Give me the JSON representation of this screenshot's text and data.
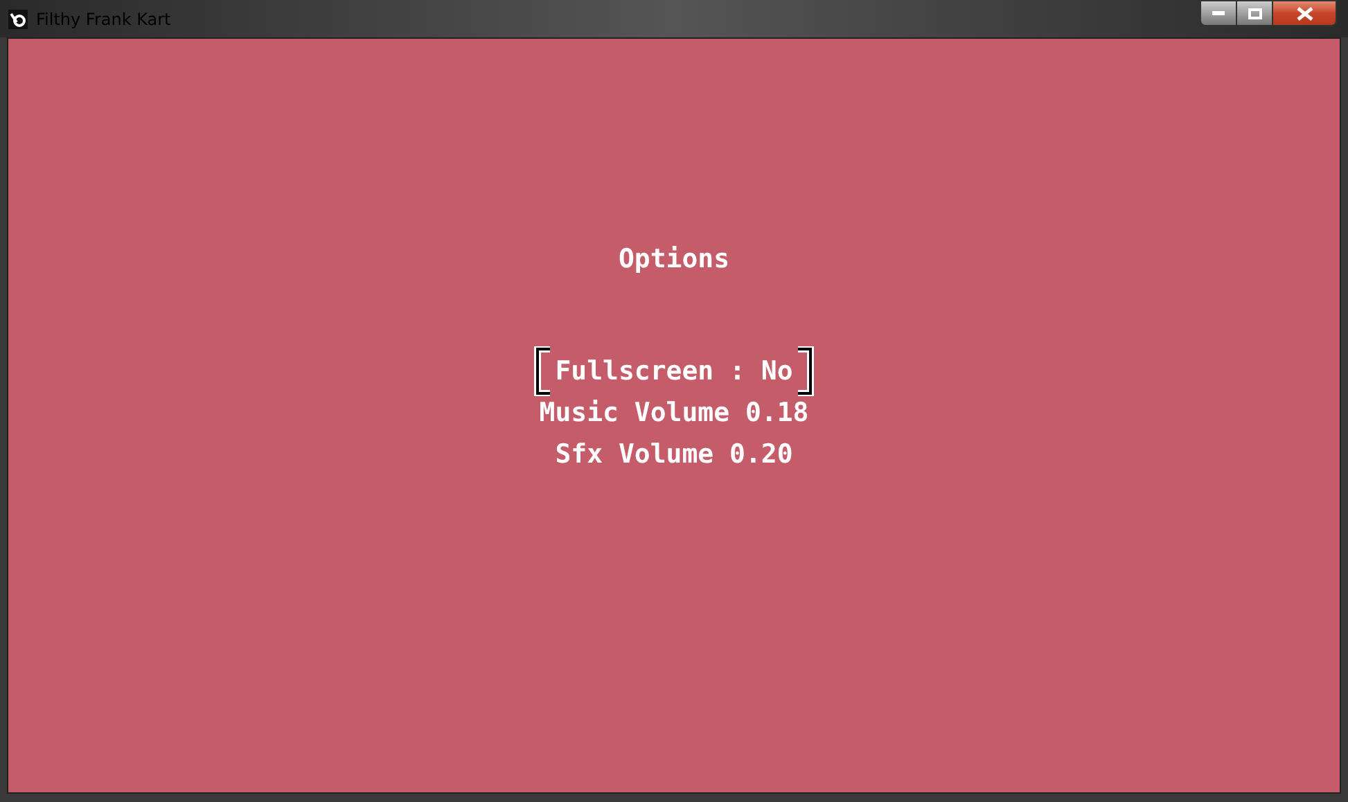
{
  "window": {
    "title": "Filthy Frank Kart"
  },
  "screen": {
    "title": "Options"
  },
  "menu": [
    {
      "label": "Fullscreen : No",
      "selected": true
    },
    {
      "label": "Music Volume 0.18",
      "selected": false
    },
    {
      "label": "Sfx Volume 0.20",
      "selected": false
    }
  ]
}
